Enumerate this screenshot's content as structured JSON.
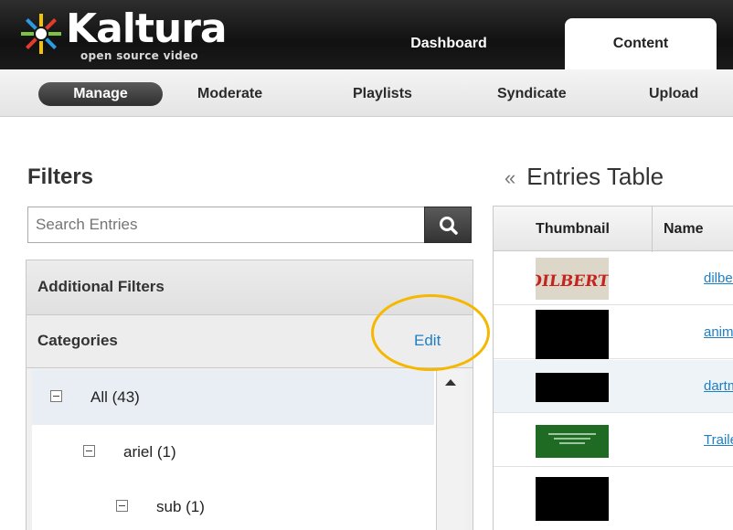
{
  "header": {
    "logo_text": "Kaltura",
    "logo_tagline": "open source video",
    "tabs": [
      {
        "label": "Dashboard",
        "active": false
      },
      {
        "label": "Content",
        "active": true
      }
    ]
  },
  "subnav": {
    "items": [
      {
        "label": "Manage",
        "active": true
      },
      {
        "label": "Moderate",
        "active": false
      },
      {
        "label": "Playlists",
        "active": false
      },
      {
        "label": "Syndicate",
        "active": false
      },
      {
        "label": "Upload",
        "active": false
      }
    ]
  },
  "filters": {
    "title": "Filters",
    "search_placeholder": "Search Entries",
    "additional_filters_label": "Additional Filters",
    "categories_label": "Categories",
    "edit_label": "Edit",
    "tree": [
      {
        "label": "All (43)",
        "selected": true
      },
      {
        "label": "ariel (1)",
        "selected": false
      },
      {
        "label": "sub (1)",
        "selected": false
      }
    ]
  },
  "entries": {
    "collapse_glyph": "«",
    "title": "Entries Table",
    "columns": [
      "Thumbnail",
      "Name"
    ],
    "rows": [
      {
        "thumb_text": "DILBERT",
        "name": "dilbert"
      },
      {
        "thumb_text": "",
        "name": "animat"
      },
      {
        "thumb_text": "",
        "name": "dartmo"
      },
      {
        "thumb_text": "",
        "name": "Trailer"
      }
    ]
  },
  "colors": {
    "accent_link": "#1f7fc4",
    "highlight_ring": "#f5b700",
    "header_bg": "#1a1a1a"
  }
}
